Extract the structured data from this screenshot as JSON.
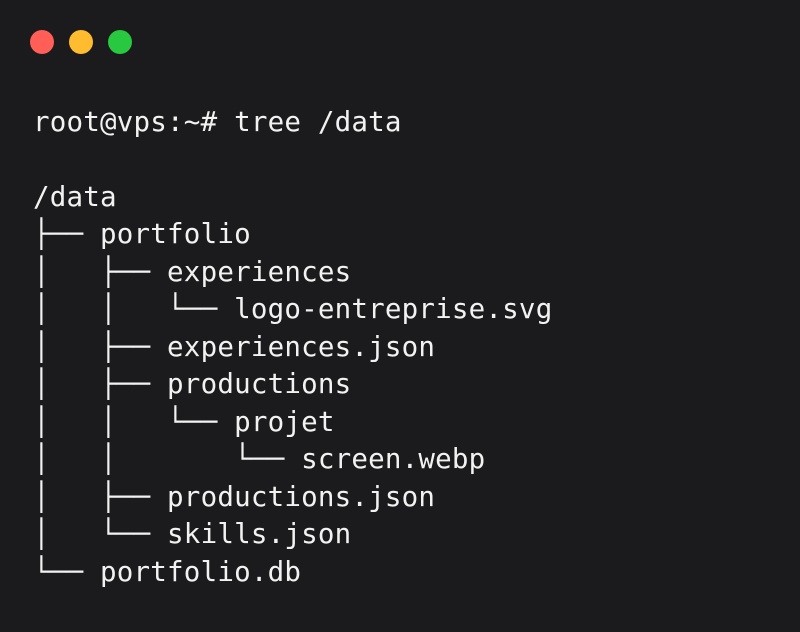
{
  "colors": {
    "background": "#1b1b1d",
    "text": "#f2f2f2",
    "close": "#ff5f57",
    "minimize": "#febc2e",
    "maximize": "#28c840"
  },
  "window_controls": {
    "close_icon": "red-circle",
    "minimize_icon": "yellow-circle",
    "maximize_icon": "green-circle"
  },
  "terminal": {
    "prompt": "root@vps:~#",
    "command": "tree /data",
    "output": [
      "/data",
      "├── portfolio",
      "│   ├── experiences",
      "│   │   └── logo-entreprise.svg",
      "│   ├── experiences.json",
      "│   ├── productions",
      "│   │   └── projet",
      "│   │       └── screen.webp",
      "│   ├── productions.json",
      "│   └── skills.json",
      "└── portfolio.db"
    ]
  }
}
